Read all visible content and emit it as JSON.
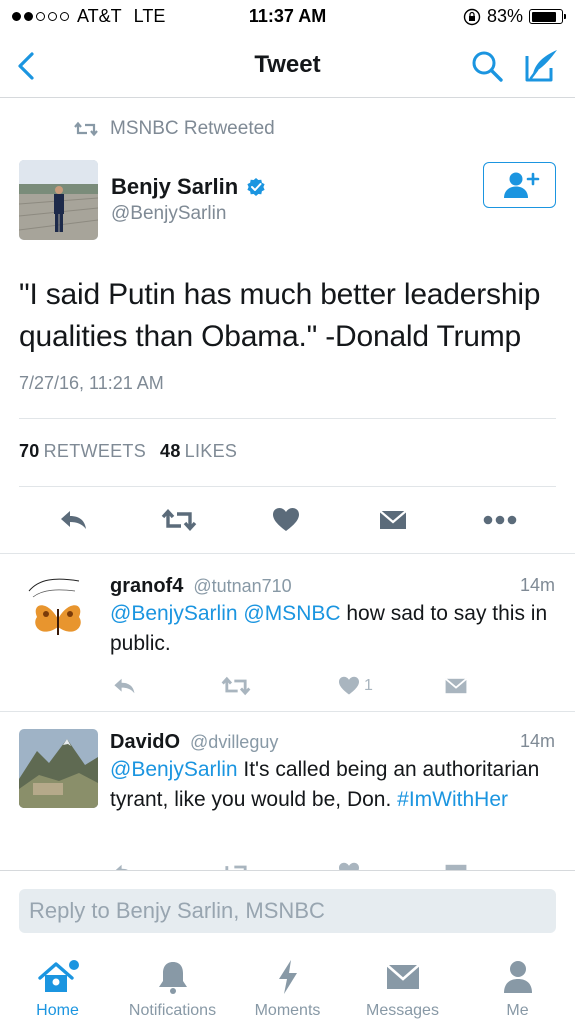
{
  "status_bar": {
    "carrier": "AT&T",
    "network": "LTE",
    "time": "11:37 AM",
    "battery": "83%",
    "battery_level": 0.83
  },
  "nav": {
    "title": "Tweet",
    "back_icon": "chevron-left-icon",
    "search_icon": "search-icon",
    "compose_icon": "compose-icon"
  },
  "tweet": {
    "retweeted_by": "MSNBC Retweeted",
    "author_name": "Benjy Sarlin",
    "author_handle": "@BenjySarlin",
    "text": "\"I said Putin has much better leadership qualities than Obama.\"  -Donald Trump",
    "timestamp": "7/27/16, 11:21 AM",
    "retweets_count": "70",
    "retweets_label": "RETWEETS",
    "likes_count": "48",
    "likes_label": "LIKES"
  },
  "replies": [
    {
      "name": "granof4",
      "handle": "@tutnan710",
      "time": "14m",
      "mentions": "@BenjySarlin @MSNBC",
      "text": " how sad to say this in public.",
      "likes": "1"
    },
    {
      "name": "DavidO",
      "handle": "@dvilleguy",
      "time": "14m",
      "mention": "@BenjySarlin",
      "text": " It's called being an authoritarian tyrant, like you would be, Don. ",
      "hashtag": "#ImWithHer"
    }
  ],
  "reply_box": {
    "placeholder": "Reply to Benjy Sarlin, MSNBC"
  },
  "tabs": [
    {
      "label": "Home",
      "icon": "home-icon",
      "active": true
    },
    {
      "label": "Notifications",
      "icon": "bell-icon",
      "active": false
    },
    {
      "label": "Moments",
      "icon": "lightning-icon",
      "active": false
    },
    {
      "label": "Messages",
      "icon": "envelope-icon",
      "active": false
    },
    {
      "label": "Me",
      "icon": "person-icon",
      "active": false
    }
  ],
  "colors": {
    "accent": "#1b95e0",
    "muted": "#7f8a95",
    "icon_gray": "#a9b5bf"
  }
}
